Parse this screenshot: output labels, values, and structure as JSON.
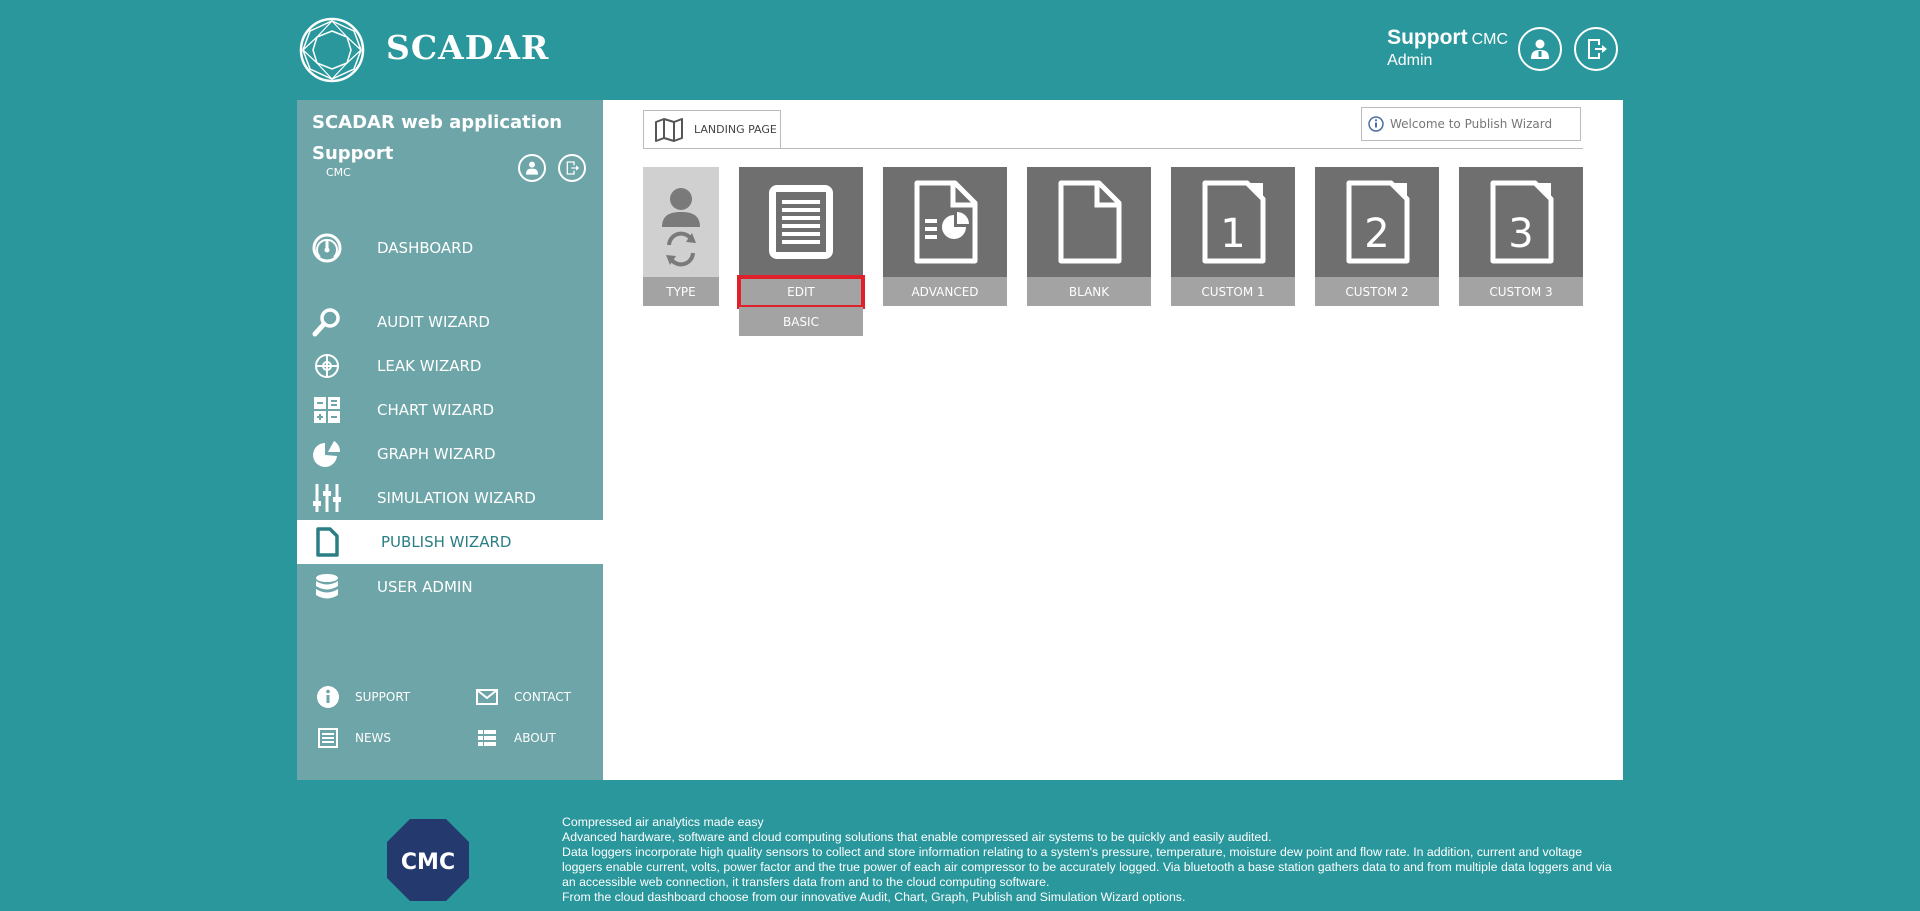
{
  "header": {
    "brand": "SCADAR",
    "user_name": "Support",
    "user_org": "CMC",
    "user_role": "Admin",
    "profile_icon": "user-icon",
    "logout_icon": "logout-icon"
  },
  "sidebar": {
    "title": "SCADAR web application",
    "user": "Support",
    "org": "CMC",
    "nav": [
      {
        "label": "DASHBOARD",
        "icon": "dashboard-gauge-icon"
      },
      {
        "label": "AUDIT WIZARD",
        "icon": "magnifier-icon"
      },
      {
        "label": "LEAK WIZARD",
        "icon": "crosshair-icon"
      },
      {
        "label": "CHART WIZARD",
        "icon": "calculator-icon"
      },
      {
        "label": "GRAPH WIZARD",
        "icon": "pie-chart-icon"
      },
      {
        "label": "SIMULATION WIZARD",
        "icon": "sliders-icon"
      },
      {
        "label": "PUBLISH WIZARD",
        "icon": "document-icon",
        "active": true
      },
      {
        "label": "USER ADMIN",
        "icon": "database-icon"
      }
    ],
    "footer_links": [
      {
        "label": "SUPPORT",
        "icon": "info-icon"
      },
      {
        "label": "CONTACT",
        "icon": "mail-icon"
      },
      {
        "label": "NEWS",
        "icon": "newspaper-icon"
      },
      {
        "label": "ABOUT",
        "icon": "list-icon"
      }
    ]
  },
  "main": {
    "tab_label": "LANDING PAGE",
    "tab_icon": "map-icon",
    "welcome": "Welcome to Publish Wizard",
    "tiles": {
      "type": "TYPE",
      "edit": "EDIT",
      "basic": "BASIC",
      "advanced": "ADVANCED",
      "blank": "BLANK",
      "custom1": "CUSTOM 1",
      "custom2": "CUSTOM 2",
      "custom3": "CUSTOM 3"
    },
    "highlight_color": "#e0202b"
  },
  "footer": {
    "logo_text": "CMC",
    "lines": [
      "Compressed air analytics made easy",
      "Advanced hardware, software and cloud computing solutions that enable compressed air systems to be quickly and easily audited.",
      "Data loggers incorporate high quality sensors to collect and store information relating to a system's pressure, temperature, moisture dew point and flow rate. In addition, current and voltage loggers enable current, volts, power factor and the true power of each air compressor to be accurately logged. Via bluetooth a base station gathers data to and from multiple data loggers and via an accessible web connection, it transfers data from and to the cloud computing software.",
      "From the cloud dashboard choose from our innovative Audit, Chart, Graph, Publish and Simulation Wizard options."
    ]
  },
  "colors": {
    "background": "#2a979c",
    "sidebar": "#6ea5a8",
    "tile": "#6f6f6f",
    "tile_label": "#a3a3a3",
    "cmc_logo": "#243a6e"
  }
}
